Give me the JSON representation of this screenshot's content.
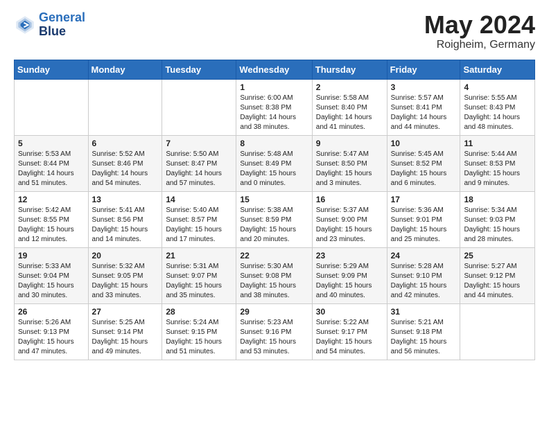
{
  "header": {
    "logo_line1": "General",
    "logo_line2": "Blue",
    "month_year": "May 2024",
    "location": "Roigheim, Germany"
  },
  "weekdays": [
    "Sunday",
    "Monday",
    "Tuesday",
    "Wednesday",
    "Thursday",
    "Friday",
    "Saturday"
  ],
  "weeks": [
    [
      {
        "day": "",
        "info": ""
      },
      {
        "day": "",
        "info": ""
      },
      {
        "day": "",
        "info": ""
      },
      {
        "day": "1",
        "info": "Sunrise: 6:00 AM\nSunset: 8:38 PM\nDaylight: 14 hours\nand 38 minutes."
      },
      {
        "day": "2",
        "info": "Sunrise: 5:58 AM\nSunset: 8:40 PM\nDaylight: 14 hours\nand 41 minutes."
      },
      {
        "day": "3",
        "info": "Sunrise: 5:57 AM\nSunset: 8:41 PM\nDaylight: 14 hours\nand 44 minutes."
      },
      {
        "day": "4",
        "info": "Sunrise: 5:55 AM\nSunset: 8:43 PM\nDaylight: 14 hours\nand 48 minutes."
      }
    ],
    [
      {
        "day": "5",
        "info": "Sunrise: 5:53 AM\nSunset: 8:44 PM\nDaylight: 14 hours\nand 51 minutes."
      },
      {
        "day": "6",
        "info": "Sunrise: 5:52 AM\nSunset: 8:46 PM\nDaylight: 14 hours\nand 54 minutes."
      },
      {
        "day": "7",
        "info": "Sunrise: 5:50 AM\nSunset: 8:47 PM\nDaylight: 14 hours\nand 57 minutes."
      },
      {
        "day": "8",
        "info": "Sunrise: 5:48 AM\nSunset: 8:49 PM\nDaylight: 15 hours\nand 0 minutes."
      },
      {
        "day": "9",
        "info": "Sunrise: 5:47 AM\nSunset: 8:50 PM\nDaylight: 15 hours\nand 3 minutes."
      },
      {
        "day": "10",
        "info": "Sunrise: 5:45 AM\nSunset: 8:52 PM\nDaylight: 15 hours\nand 6 minutes."
      },
      {
        "day": "11",
        "info": "Sunrise: 5:44 AM\nSunset: 8:53 PM\nDaylight: 15 hours\nand 9 minutes."
      }
    ],
    [
      {
        "day": "12",
        "info": "Sunrise: 5:42 AM\nSunset: 8:55 PM\nDaylight: 15 hours\nand 12 minutes."
      },
      {
        "day": "13",
        "info": "Sunrise: 5:41 AM\nSunset: 8:56 PM\nDaylight: 15 hours\nand 14 minutes."
      },
      {
        "day": "14",
        "info": "Sunrise: 5:40 AM\nSunset: 8:57 PM\nDaylight: 15 hours\nand 17 minutes."
      },
      {
        "day": "15",
        "info": "Sunrise: 5:38 AM\nSunset: 8:59 PM\nDaylight: 15 hours\nand 20 minutes."
      },
      {
        "day": "16",
        "info": "Sunrise: 5:37 AM\nSunset: 9:00 PM\nDaylight: 15 hours\nand 23 minutes."
      },
      {
        "day": "17",
        "info": "Sunrise: 5:36 AM\nSunset: 9:01 PM\nDaylight: 15 hours\nand 25 minutes."
      },
      {
        "day": "18",
        "info": "Sunrise: 5:34 AM\nSunset: 9:03 PM\nDaylight: 15 hours\nand 28 minutes."
      }
    ],
    [
      {
        "day": "19",
        "info": "Sunrise: 5:33 AM\nSunset: 9:04 PM\nDaylight: 15 hours\nand 30 minutes."
      },
      {
        "day": "20",
        "info": "Sunrise: 5:32 AM\nSunset: 9:05 PM\nDaylight: 15 hours\nand 33 minutes."
      },
      {
        "day": "21",
        "info": "Sunrise: 5:31 AM\nSunset: 9:07 PM\nDaylight: 15 hours\nand 35 minutes."
      },
      {
        "day": "22",
        "info": "Sunrise: 5:30 AM\nSunset: 9:08 PM\nDaylight: 15 hours\nand 38 minutes."
      },
      {
        "day": "23",
        "info": "Sunrise: 5:29 AM\nSunset: 9:09 PM\nDaylight: 15 hours\nand 40 minutes."
      },
      {
        "day": "24",
        "info": "Sunrise: 5:28 AM\nSunset: 9:10 PM\nDaylight: 15 hours\nand 42 minutes."
      },
      {
        "day": "25",
        "info": "Sunrise: 5:27 AM\nSunset: 9:12 PM\nDaylight: 15 hours\nand 44 minutes."
      }
    ],
    [
      {
        "day": "26",
        "info": "Sunrise: 5:26 AM\nSunset: 9:13 PM\nDaylight: 15 hours\nand 47 minutes."
      },
      {
        "day": "27",
        "info": "Sunrise: 5:25 AM\nSunset: 9:14 PM\nDaylight: 15 hours\nand 49 minutes."
      },
      {
        "day": "28",
        "info": "Sunrise: 5:24 AM\nSunset: 9:15 PM\nDaylight: 15 hours\nand 51 minutes."
      },
      {
        "day": "29",
        "info": "Sunrise: 5:23 AM\nSunset: 9:16 PM\nDaylight: 15 hours\nand 53 minutes."
      },
      {
        "day": "30",
        "info": "Sunrise: 5:22 AM\nSunset: 9:17 PM\nDaylight: 15 hours\nand 54 minutes."
      },
      {
        "day": "31",
        "info": "Sunrise: 5:21 AM\nSunset: 9:18 PM\nDaylight: 15 hours\nand 56 minutes."
      },
      {
        "day": "",
        "info": ""
      }
    ]
  ]
}
